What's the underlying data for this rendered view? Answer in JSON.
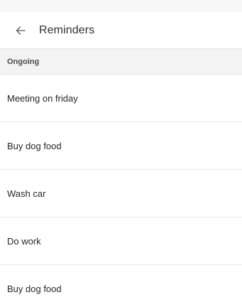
{
  "header": {
    "back_icon": "arrow-back-icon",
    "title": "Reminders"
  },
  "section": {
    "label": "Ongoing"
  },
  "reminders": [
    {
      "label": "Meeting on friday"
    },
    {
      "label": "Buy dog food"
    },
    {
      "label": "Wash car"
    },
    {
      "label": "Do work"
    },
    {
      "label": "Buy dog food"
    }
  ]
}
